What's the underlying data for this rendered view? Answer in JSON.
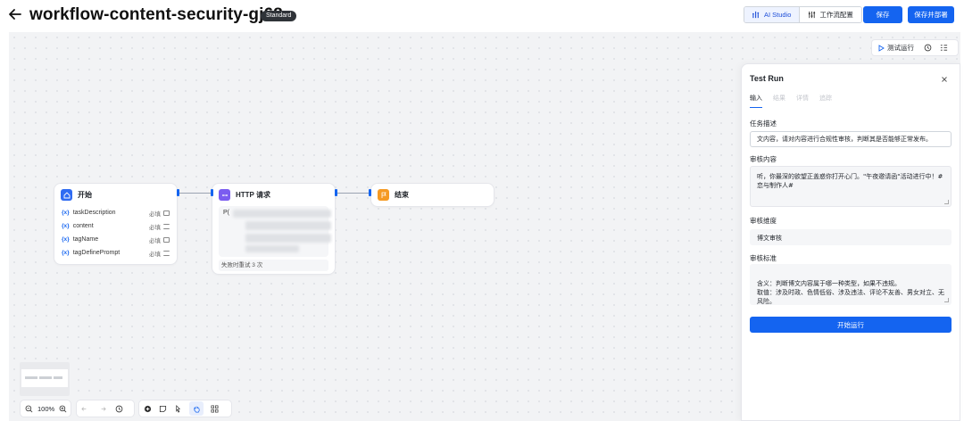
{
  "header": {
    "title": "workflow-content-security-gj68",
    "badge": "Standard",
    "ai_studio_label": "AI Studio",
    "workflow_config_label": "工作流配置",
    "save_label": "保存",
    "save_deploy_label": "保存并部署"
  },
  "canvas_toolbar": {
    "test_run_label": "测试运行"
  },
  "nodes": {
    "start": {
      "title": "开始",
      "variables": [
        {
          "symbol": "{x}",
          "name": "taskDescription",
          "required": "必填"
        },
        {
          "symbol": "{x}",
          "name": "content",
          "required": "必填"
        },
        {
          "symbol": "{x}",
          "name": "tagName",
          "required": "必填"
        },
        {
          "symbol": "{x}",
          "name": "tagDefinePrompt",
          "required": "必填"
        }
      ]
    },
    "http": {
      "title": "HTTP 请求",
      "body_prefix": "P(",
      "retry_text": "失败时重试 3 次"
    },
    "end": {
      "title": "结束"
    }
  },
  "bottom_toolbar": {
    "zoom_level": "100%"
  },
  "test_run": {
    "title": "Test Run",
    "tabs": [
      "输入",
      "结果",
      "详情",
      "追踪"
    ],
    "fields": [
      {
        "label": "任务描述",
        "value": "文内容，请对内容进行合规性审核，判断其是否能够正常发布。"
      },
      {
        "label": "审核内容",
        "value": "听，你最深的欲望正盖惑你打开心门。\"午夜邀请函\"活动进行中！#恋与制作人#"
      },
      {
        "label": "审核维度",
        "value": "博文审核"
      },
      {
        "label": "审核标准",
        "value": "含义：判断博文内容属于哪一种类型，如果不违规。\n取值：涉及时政、色情低俗、涉及违法、评论不友善、男女对立、无风险。"
      }
    ],
    "start_label": "开始运行"
  },
  "colors": {
    "primary": "#1464f0",
    "start_icon": "#2f6bf2",
    "http_icon": "#7b5cf0",
    "end_icon": "#f59a23"
  }
}
